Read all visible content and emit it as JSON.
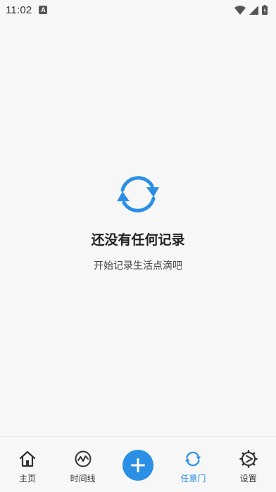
{
  "status_bar": {
    "time": "11:02",
    "notification_glyph": "A",
    "icons": [
      "wifi-icon",
      "signal-icon",
      "battery-icon"
    ]
  },
  "empty_state": {
    "icon": "sync-icon",
    "title": "还没有任何记录",
    "subtitle": "开始记录生活点滴吧"
  },
  "bottom_nav": {
    "items": [
      {
        "label": "主页",
        "icon": "home-icon"
      },
      {
        "label": "时间线",
        "icon": "timeline-icon"
      },
      {
        "label": "",
        "icon": "add-icon"
      },
      {
        "label": "任意门",
        "icon": "sync-icon",
        "active": true
      },
      {
        "label": "设置",
        "icon": "settings-icon"
      }
    ]
  },
  "colors": {
    "accent": "#2b8fe6",
    "background": "#f7f7f7",
    "text": "#222222"
  }
}
